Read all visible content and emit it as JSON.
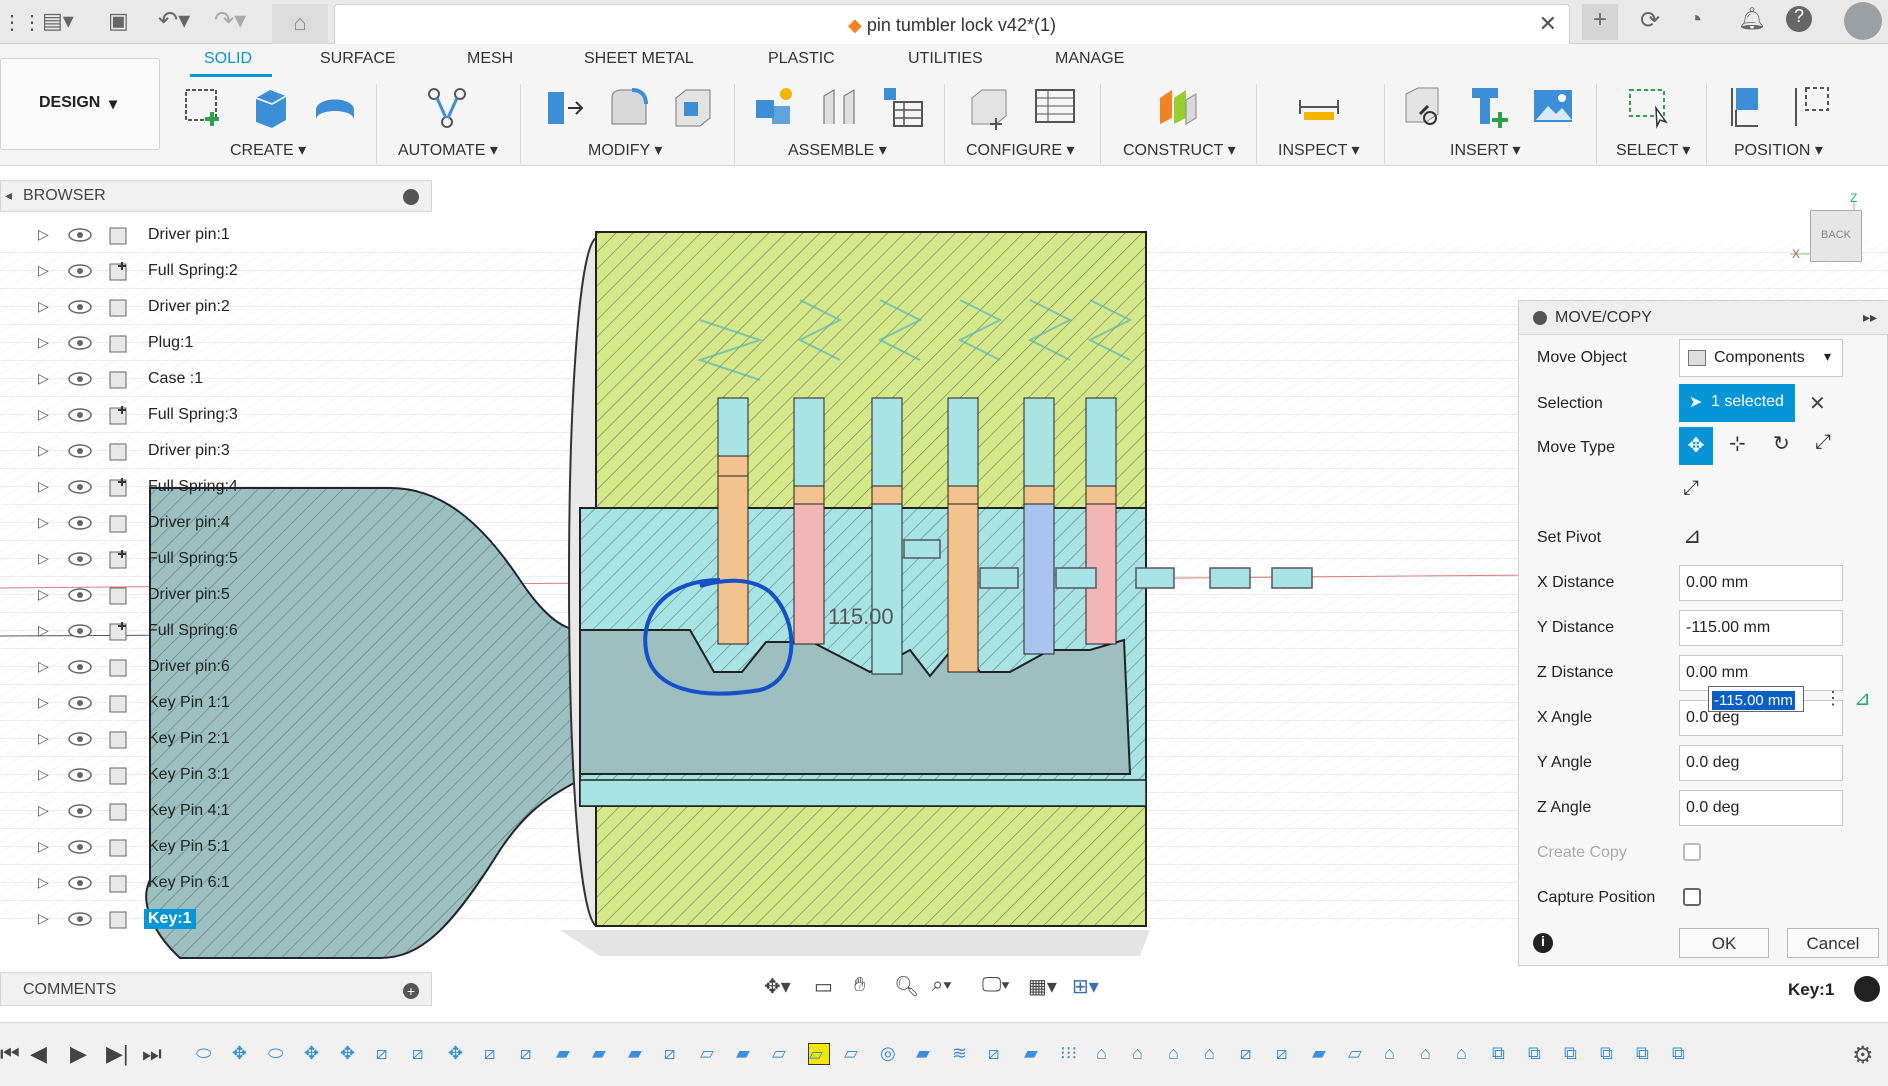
{
  "window": {
    "title": "pin tumbler lock v42*(1)"
  },
  "ribbon": {
    "workspace": "DESIGN",
    "tabs": [
      {
        "label": "SOLID",
        "active": true
      },
      {
        "label": "SURFACE"
      },
      {
        "label": "MESH"
      },
      {
        "label": "SHEET METAL"
      },
      {
        "label": "PLASTIC"
      },
      {
        "label": "UTILITIES"
      },
      {
        "label": "MANAGE"
      }
    ],
    "groups": [
      "CREATE",
      "AUTOMATE",
      "MODIFY",
      "ASSEMBLE",
      "CONFIGURE",
      "CONSTRUCT",
      "INSPECT",
      "INSERT",
      "SELECT",
      "POSITION"
    ]
  },
  "browser": {
    "title": "BROWSER",
    "items": [
      {
        "label": "Driver pin:1",
        "icon": "component-icon"
      },
      {
        "label": "Full Spring:2",
        "icon": "spring-component-icon"
      },
      {
        "label": "Driver pin:2",
        "icon": "component-icon"
      },
      {
        "label": "Plug:1",
        "icon": "component-icon"
      },
      {
        "label": "Case :1",
        "icon": "component-icon"
      },
      {
        "label": "Full Spring:3",
        "icon": "spring-component-icon"
      },
      {
        "label": "Driver pin:3",
        "icon": "component-icon"
      },
      {
        "label": "Full Spring:4",
        "icon": "spring-component-icon"
      },
      {
        "label": "Driver pin:4",
        "icon": "component-icon"
      },
      {
        "label": "Full Spring:5",
        "icon": "spring-component-icon"
      },
      {
        "label": "Driver pin:5",
        "icon": "component-icon"
      },
      {
        "label": "Full Spring:6",
        "icon": "spring-component-icon"
      },
      {
        "label": "Driver pin:6",
        "icon": "component-icon"
      },
      {
        "label": "Key Pin 1:1",
        "icon": "component-icon"
      },
      {
        "label": "Key Pin 2:1",
        "icon": "component-icon"
      },
      {
        "label": "Key Pin 3:1",
        "icon": "component-icon"
      },
      {
        "label": "Key Pin 4:1",
        "icon": "component-icon"
      },
      {
        "label": "Key Pin 5:1",
        "icon": "component-icon"
      },
      {
        "label": "Key Pin 6:1",
        "icon": "component-icon"
      },
      {
        "label": "Key:1",
        "icon": "component-icon",
        "selected": true
      }
    ]
  },
  "comments": {
    "title": "COMMENTS"
  },
  "canvas": {
    "dimension_label": "115.00",
    "viewcube_label": "BACK"
  },
  "move_copy": {
    "title": "MOVE/COPY",
    "move_object_label": "Move Object",
    "move_object_value": "Components",
    "selection_label": "Selection",
    "selection_value": "1 selected",
    "move_type_label": "Move Type",
    "set_pivot_label": "Set Pivot",
    "x_distance_label": "X Distance",
    "x_distance_value": "0.00 mm",
    "y_distance_label": "Y Distance",
    "y_distance_value": "-115.00 mm",
    "z_distance_label": "Z Distance",
    "z_distance_value": "0.00 mm",
    "x_angle_label": "X Angle",
    "x_angle_value": "0.0 deg",
    "y_angle_label": "Y Angle",
    "y_angle_value": "0.0 deg",
    "z_angle_label": "Z Angle",
    "z_angle_value": "0.0 deg",
    "create_copy_label": "Create Copy",
    "capture_position_label": "Capture Position",
    "ok_label": "OK",
    "cancel_label": "Cancel",
    "inline_edit_value": "-115.00 mm"
  },
  "status": {
    "selected_item": "Key:1"
  },
  "colors": {
    "accent": "#0696d7",
    "case": "#d6e98a",
    "plug": "#a8e4e4",
    "key": "#9cc0c0"
  }
}
